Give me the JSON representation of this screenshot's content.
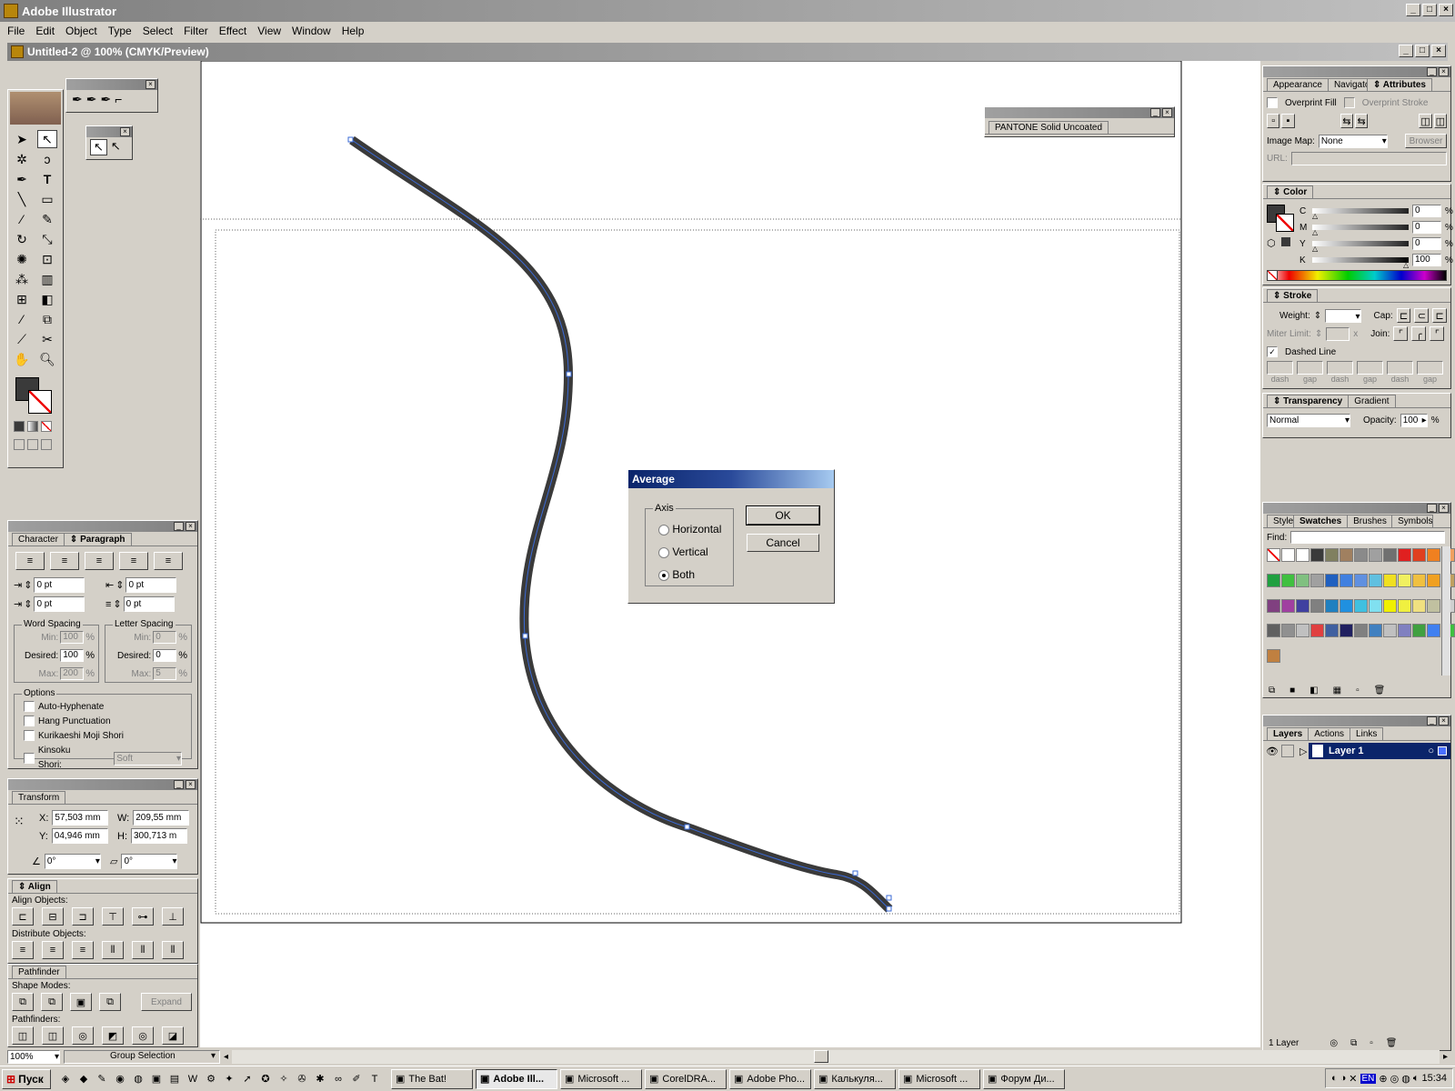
{
  "app": {
    "title": "Adobe Illustrator"
  },
  "menu": [
    "File",
    "Edit",
    "Object",
    "Type",
    "Select",
    "Filter",
    "Effect",
    "View",
    "Window",
    "Help"
  ],
  "document": {
    "title": "Untitled-2 @ 100% (CMYK/Preview)"
  },
  "pantone_panel": {
    "label": "PANTONE Solid Uncoated"
  },
  "dialog": {
    "title": "Average",
    "axis_label": "Axis",
    "options": [
      "Horizontal",
      "Vertical",
      "Both"
    ],
    "selected": "Both",
    "ok": "OK",
    "cancel": "Cancel"
  },
  "char_panel": {
    "tabs": [
      "Character",
      "Paragraph"
    ],
    "indent_left": "0 pt",
    "indent_right": "0 pt",
    "first_line": "0 pt",
    "space_before": "0 pt",
    "word_spacing": "Word Spacing",
    "letter_spacing": "Letter Spacing",
    "min_label": "Min:",
    "desired_label": "Desired:",
    "max_label": "Max:",
    "ws_min": "100",
    "ws_desired": "100",
    "ws_max": "200",
    "ls_min": "0",
    "ls_desired": "0",
    "ls_max": "5",
    "pct": "%",
    "options_label": "Options",
    "auto_hyphenate": "Auto-Hyphenate",
    "hang_punct": "Hang Punctuation",
    "kurikaeshi": "Kurikaeshi Moji Shori",
    "kinsoku": "Kinsoku Shori:",
    "kinsoku_value": "Soft"
  },
  "transform": {
    "tab": "Transform",
    "x_label": "X:",
    "x": "57,503 mm",
    "y_label": "Y:",
    "y": "04,946 mm",
    "w_label": "W:",
    "w": "209,55 mm",
    "h_label": "H:",
    "h": "300,713 m",
    "rotate": "0°",
    "shear": "0°"
  },
  "align": {
    "tab": "Align",
    "objects_label": "Align Objects:",
    "distribute_label": "Distribute Objects:"
  },
  "pathfinder": {
    "tab": "Pathfinder",
    "shape_modes": "Shape Modes:",
    "expand": "Expand",
    "pathfinders": "Pathfinders:"
  },
  "attributes": {
    "tabs": [
      "Appearance",
      "Navigator",
      "Attributes"
    ],
    "overprint_fill": "Overprint Fill",
    "overprint_stroke": "Overprint Stroke",
    "image_map": "Image Map:",
    "image_map_value": "None",
    "browser": "Browser",
    "url": "URL:"
  },
  "color": {
    "tab": "Color",
    "c_label": "C",
    "m_label": "M",
    "y_label": "Y",
    "k_label": "K",
    "c": 0,
    "m": 0,
    "y": 0,
    "k": 100,
    "c_str": "0",
    "m_str": "0",
    "y_str": "0",
    "k_str": "100",
    "pct": "%"
  },
  "stroke": {
    "tab": "Stroke",
    "weight": "Weight:",
    "cap": "Cap:",
    "miter": "Miter Limit:",
    "join": "Join:",
    "miter_x": "x",
    "dashed": "Dashed Line",
    "dash_labels": [
      "dash",
      "gap",
      "dash",
      "gap",
      "dash",
      "gap"
    ]
  },
  "transparency": {
    "tabs": [
      "Transparency",
      "Gradient"
    ],
    "mode": "Normal",
    "opacity_label": "Opacity:",
    "opacity": "100",
    "pct": "%"
  },
  "swatches": {
    "tabs": [
      "Styles",
      "Swatches",
      "Brushes",
      "Symbols"
    ],
    "find": "Find:",
    "colors": [
      "#ffffff",
      "#ffffff",
      "#ffffff",
      "#3a3a3a",
      "#808060",
      "#a08060",
      "#8a8a8a",
      "#a0a0a0",
      "#707070",
      "#e02020",
      "#e04020",
      "#f08020",
      "#f0a060",
      "#20a040",
      "#40c040",
      "#80c080",
      "#a0a0a0",
      "#2060c0",
      "#4080e0",
      "#6090e0",
      "#60c0e0",
      "#f0e020",
      "#f0f060",
      "#f0c040",
      "#f0a020",
      "#c0a060",
      "#804080",
      "#a040a0",
      "#4040a0",
      "#808080",
      "#2080c0",
      "#2090e0",
      "#40c0e0",
      "#80e0f0",
      "#f0f000",
      "#f0f040",
      "#f0e080",
      "#c0c0a0",
      "#d0d0d0",
      "#606060",
      "#909090",
      "#c0c0c0",
      "#e04040",
      "#4060a0",
      "#202060",
      "#808080",
      "#4080c0",
      "#c0c0c0",
      "#8080c0",
      "#40a040",
      "#4080f0",
      "#40c040",
      "#c08040"
    ]
  },
  "layers": {
    "tabs": [
      "Layers",
      "Actions",
      "Links"
    ],
    "layer_name": "Layer 1",
    "count": "1 Layer"
  },
  "status": {
    "zoom": "100%",
    "tool": "Group Selection"
  },
  "taskbar": {
    "start": "Пуск",
    "tasks": [
      "The Bat!",
      "Adobe Ill...",
      "Microsoft ...",
      "CorelDRA...",
      "Adobe Pho...",
      "Калькуля...",
      "Microsoft ...",
      "Форум Ди..."
    ],
    "tray_lang": "EN",
    "time": "15:34"
  }
}
